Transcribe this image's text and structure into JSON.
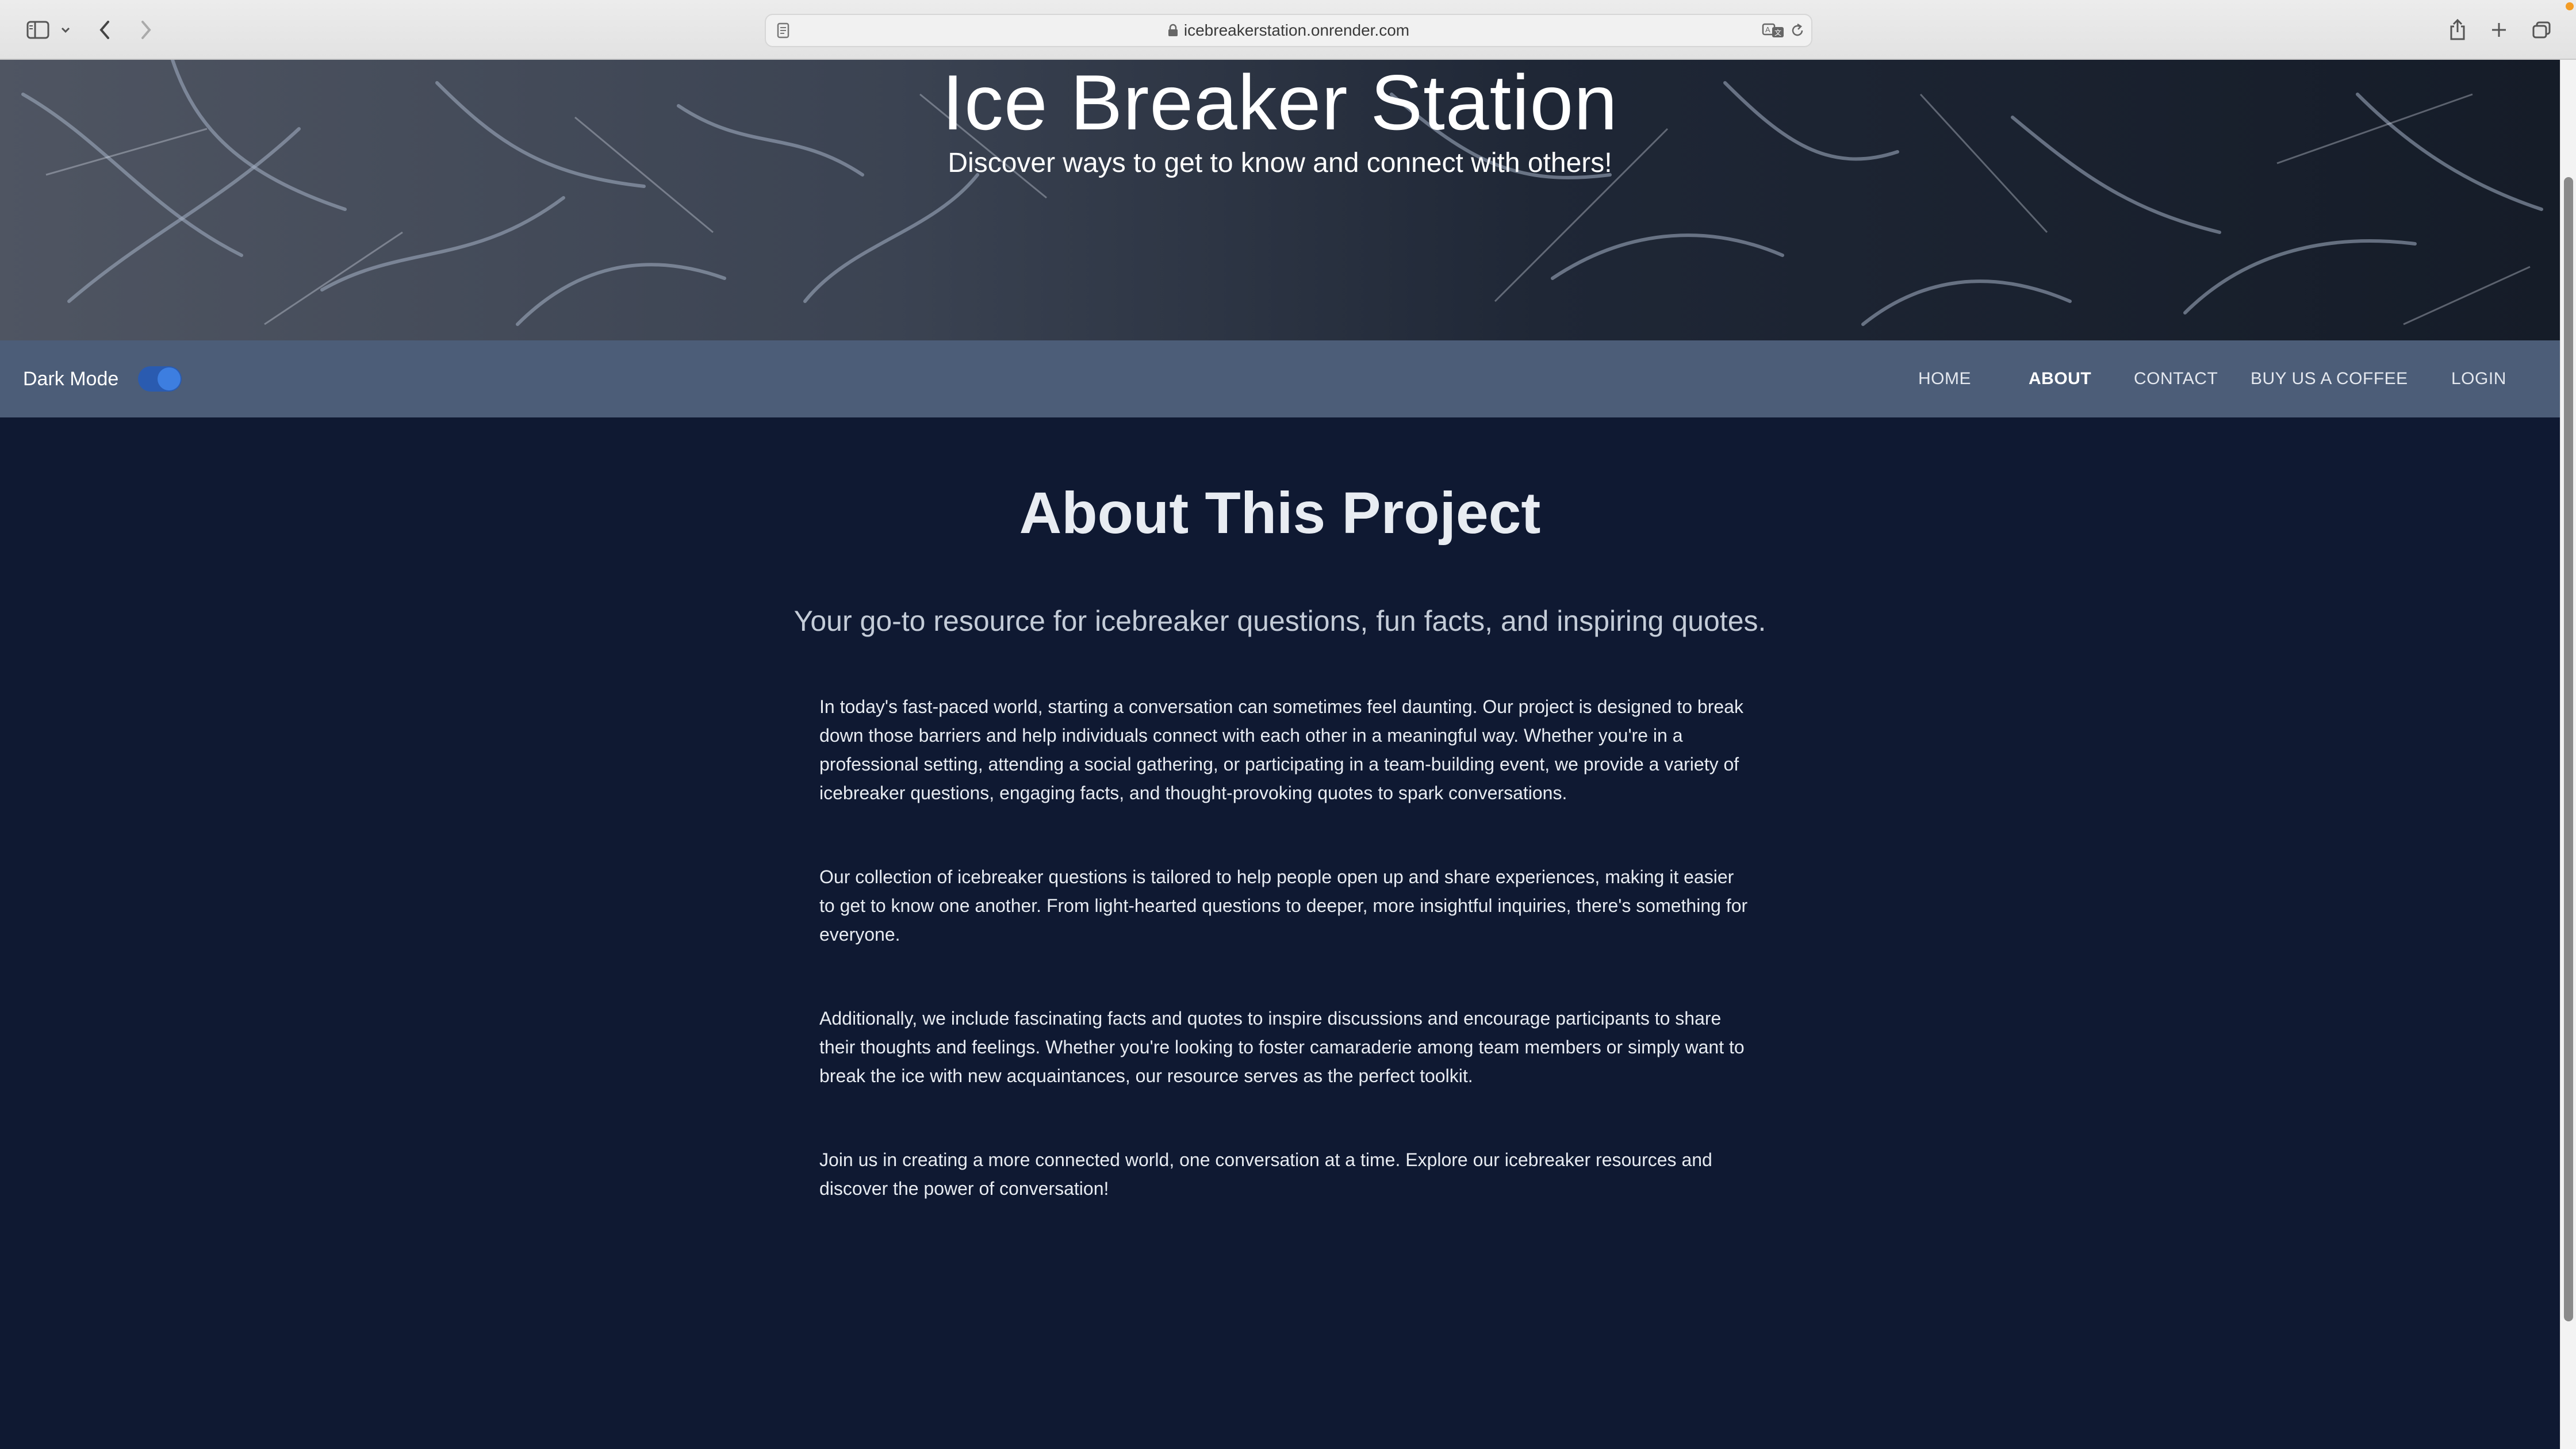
{
  "browser": {
    "url": "icebreakerstation.onrender.com",
    "icons": [
      "sidebar-icon",
      "chevron-down-icon",
      "back-icon",
      "forward-icon",
      "page-icon",
      "lock-icon",
      "translate-icon",
      "reload-icon",
      "share-icon",
      "new-tab-icon",
      "tabs-overview-icon"
    ]
  },
  "hero": {
    "title": "Ice Breaker Station",
    "subtitle": "Discover ways to get to know and connect with others!"
  },
  "nav": {
    "dark_mode_label": "Dark Mode",
    "dark_mode_on": true,
    "links": {
      "home": "HOME",
      "about": "ABOUT",
      "contact": "CONTACT",
      "coffee": "BUY US A COFFEE",
      "login": "LOGIN"
    },
    "active": "ABOUT"
  },
  "main": {
    "title": "About This Project",
    "lead": "Your go-to resource for icebreaker questions, fun facts, and inspiring quotes.",
    "paragraphs": [
      "In today's fast-paced world, starting a conversation can sometimes feel daunting. Our project is designed to break down those barriers and help individuals connect with each other in a meaningful way. Whether you're in a professional setting, attending a social gathering, or participating in a team-building event, we provide a variety of icebreaker questions, engaging facts, and thought-provoking quotes to spark conversations.",
      "Our collection of icebreaker questions is tailored to help people open up and share experiences, making it easier to get to know one another. From light-hearted questions to deeper, more insightful inquiries, there's something for everyone.",
      "Additionally, we include fascinating facts and quotes to inspire discussions and encourage participants to share their thoughts and feelings. Whether you're looking to foster camaraderie among team members or simply want to break the ice with new acquaintances, our resource serves as the perfect toolkit.",
      "Join us in creating a more connected world, one conversation at a time. Explore our icebreaker resources and discover the power of conversation!"
    ]
  },
  "colors": {
    "page_bg": "#0f1932",
    "nav_bg": "#4c5d78",
    "toggle_accent": "#3d7ee0"
  }
}
